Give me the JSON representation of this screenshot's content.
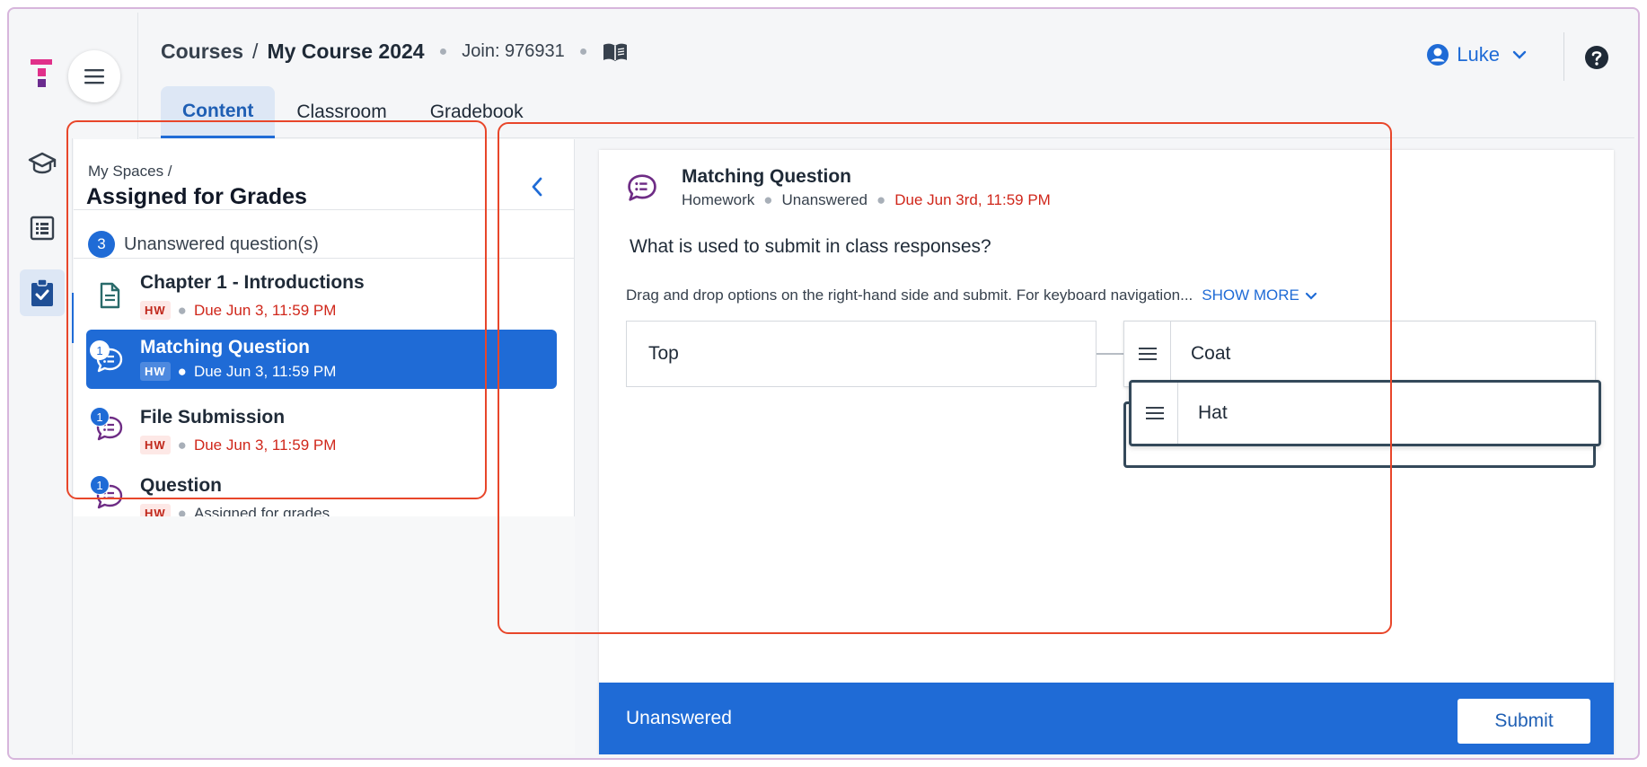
{
  "header": {
    "breadcrumb_root": "Courses",
    "breadcrumb_sep": "/",
    "course_name": "My Course 2024",
    "join_code": "Join: 976931",
    "user_name": "Luke",
    "tabs": [
      {
        "label": "Content"
      },
      {
        "label": "Classroom"
      },
      {
        "label": "Gradebook"
      }
    ]
  },
  "left_panel": {
    "crumb": "My Spaces  /",
    "title": "Assigned for Grades",
    "unanswered_count": "3",
    "unanswered_label": "Unanswered question(s)",
    "items": [
      {
        "title": "Chapter 1 - Introductions",
        "tag": "HW",
        "due": "Due Jun 3, 11:59 PM",
        "icon": "document-icon"
      },
      {
        "title": "Matching Question",
        "tag": "HW",
        "due": "Due Jun 3, 11:59 PM",
        "badge": "1",
        "icon": "question-bubble-icon"
      },
      {
        "title": "File Submission",
        "tag": "HW",
        "due": "Due Jun 3, 11:59 PM",
        "badge": "1",
        "icon": "question-bubble-icon"
      },
      {
        "title": "Question",
        "tag": "HW",
        "status": "Assigned for grades",
        "badge": "1",
        "icon": "question-bubble-icon"
      }
    ]
  },
  "question": {
    "title": "Matching Question",
    "type": "Homework",
    "status": "Unanswered",
    "due": "Due Jun 3rd, 11:59 PM",
    "prompt": "What is used to submit in class responses?",
    "instructions": "Drag and drop options on the right-hand side and submit. For keyboard navigation...",
    "show_more": "SHOW MORE",
    "left_option": "Top",
    "right_option": "Coat",
    "dragging_option": "Hat"
  },
  "footer": {
    "status": "Unanswered",
    "submit_label": "Submit"
  },
  "colors": {
    "accent": "#1f6bd6",
    "due_red": "#d0271b",
    "annotation_red": "#e8462a"
  }
}
